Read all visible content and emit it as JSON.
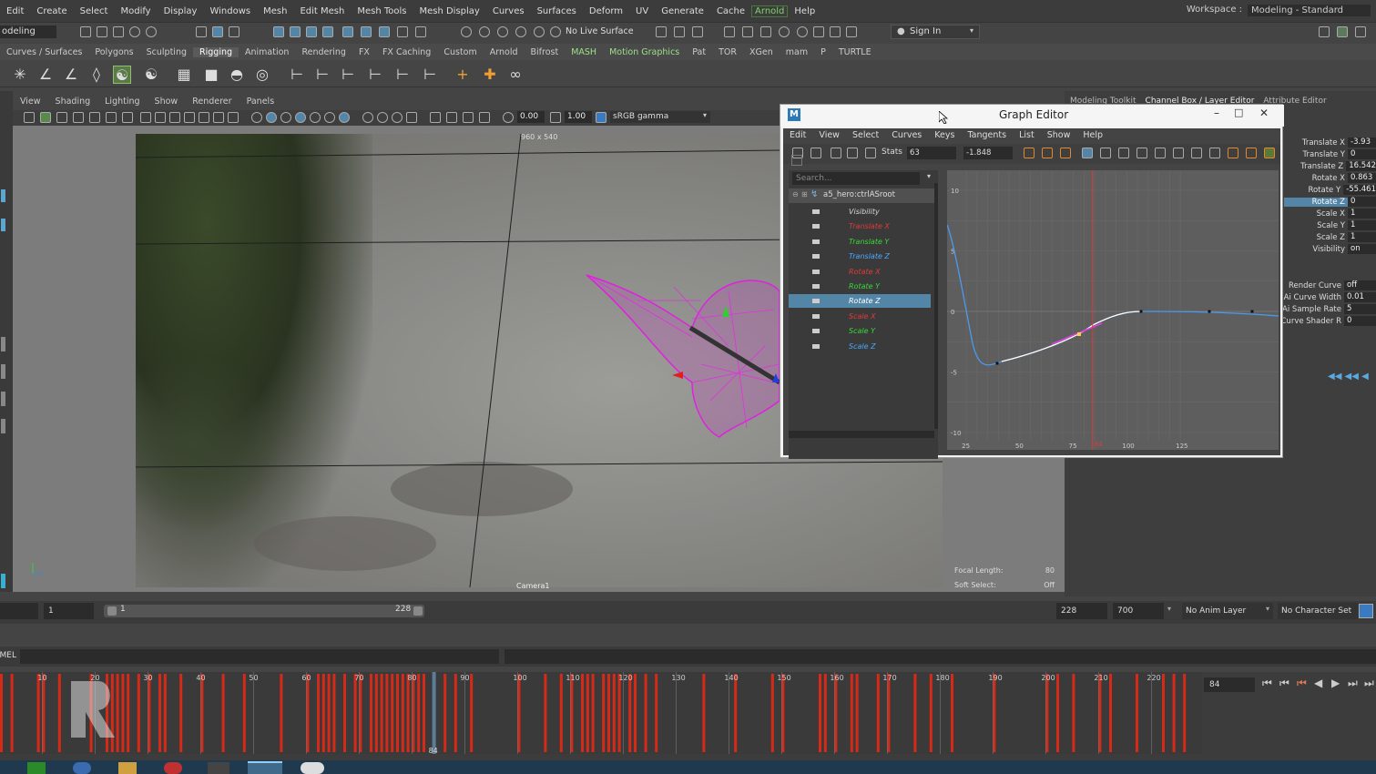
{
  "menubar": {
    "items": [
      "Edit",
      "Create",
      "Select",
      "Modify",
      "Display",
      "Windows",
      "Mesh",
      "Edit Mesh",
      "Mesh Tools",
      "Mesh Display",
      "Curves",
      "Surfaces",
      "Deform",
      "UV",
      "Generate",
      "Cache",
      "Arnold",
      "Help"
    ],
    "workspace_label": "Workspace :",
    "workspace_value": "Modeling - Standard"
  },
  "statusline": {
    "mode": "odeling",
    "live_surface": "No Live Surface",
    "sign_in": "Sign In"
  },
  "shelf": {
    "tabs": [
      "Curves / Surfaces",
      "Polygons",
      "Sculpting",
      "Rigging",
      "Animation",
      "Rendering",
      "FX",
      "FX Caching",
      "Custom",
      "Arnold",
      "Bifrost",
      "MASH",
      "Motion Graphics",
      "Pat",
      "TOR",
      "XGen",
      "mam",
      "P",
      "TURTLE"
    ],
    "active_tab": "Rigging"
  },
  "viewport": {
    "menu": [
      "View",
      "Shading",
      "Lighting",
      "Show",
      "Renderer",
      "Panels"
    ],
    "exposure": "0.00",
    "gamma": "1.00",
    "color_space": "sRGB gamma",
    "resolution": "960 x 540",
    "camera": "Camera1",
    "focal_length_label": "Focal Length:",
    "focal_length_value": "80",
    "soft_select_label": "Soft Select:",
    "soft_select_value": "Off"
  },
  "right_panel": {
    "tabs": [
      "Modeling Toolkit",
      "Channel Box / Layer Editor",
      "Attribute Editor"
    ],
    "channels": [
      {
        "label": "Translate X",
        "value": "-3.93"
      },
      {
        "label": "Translate Y",
        "value": "0"
      },
      {
        "label": "Translate Z",
        "value": "16.542"
      },
      {
        "label": "Rotate X",
        "value": "0.863"
      },
      {
        "label": "Rotate Y",
        "value": "-55.461"
      },
      {
        "label": "Rotate Z",
        "value": "0"
      },
      {
        "label": "Scale X",
        "value": "1"
      },
      {
        "label": "Scale Y",
        "value": "1"
      },
      {
        "label": "Scale Z",
        "value": "1"
      },
      {
        "label": "Visibility",
        "value": "on"
      }
    ],
    "shape_attrs": [
      {
        "label": "Render Curve",
        "value": "off"
      },
      {
        "label": "Ai Curve Width",
        "value": "0.01"
      },
      {
        "label": "Ai Sample Rate",
        "value": "5"
      },
      {
        "label": "Curve Shader R",
        "value": "0"
      }
    ]
  },
  "graph_editor": {
    "title": "Graph Editor",
    "menu": [
      "Edit",
      "View",
      "Select",
      "Curves",
      "Keys",
      "Tangents",
      "List",
      "Show",
      "Help"
    ],
    "stats_label": "Stats",
    "stats_frame": "63",
    "stats_value": "-1.848",
    "search_placeholder": "Search...",
    "root_node": "a5_hero:ctrlASroot",
    "attributes": [
      {
        "name": "Visibility",
        "color": "#d8d8d8"
      },
      {
        "name": "Translate X",
        "color": "#e03a3a"
      },
      {
        "name": "Translate Y",
        "color": "#38d838"
      },
      {
        "name": "Translate Z",
        "color": "#4aa8ff"
      },
      {
        "name": "Rotate X",
        "color": "#e03a3a"
      },
      {
        "name": "Rotate Y",
        "color": "#38d838"
      },
      {
        "name": "Rotate Z",
        "color": "#ffffff"
      },
      {
        "name": "Scale X",
        "color": "#e03a3a"
      },
      {
        "name": "Scale Y",
        "color": "#38d838"
      },
      {
        "name": "Scale Z",
        "color": "#4aa8ff"
      }
    ],
    "selected_attr": "Rotate Z",
    "y_ticks": [
      "10",
      "5",
      "0",
      "-5",
      "-10"
    ],
    "x_ticks": [
      "25",
      "50",
      "75",
      "100",
      "125"
    ],
    "current_frame": "84"
  },
  "range": {
    "start": "1",
    "inner_start": "1",
    "inner_end": "228",
    "end": "228",
    "max": "700",
    "anim_layer": "No Anim Layer",
    "char_set": "No Character Set"
  },
  "cmdline": {
    "label": "MEL"
  },
  "timeline": {
    "ticks": [
      "10",
      "20",
      "30",
      "40",
      "50",
      "60",
      "70",
      "80",
      "90",
      "100",
      "110",
      "120",
      "130",
      "140",
      "150",
      "160",
      "170",
      "180",
      "190",
      "200",
      "210",
      "220"
    ],
    "current_frame": "84",
    "frame_field": "84"
  }
}
